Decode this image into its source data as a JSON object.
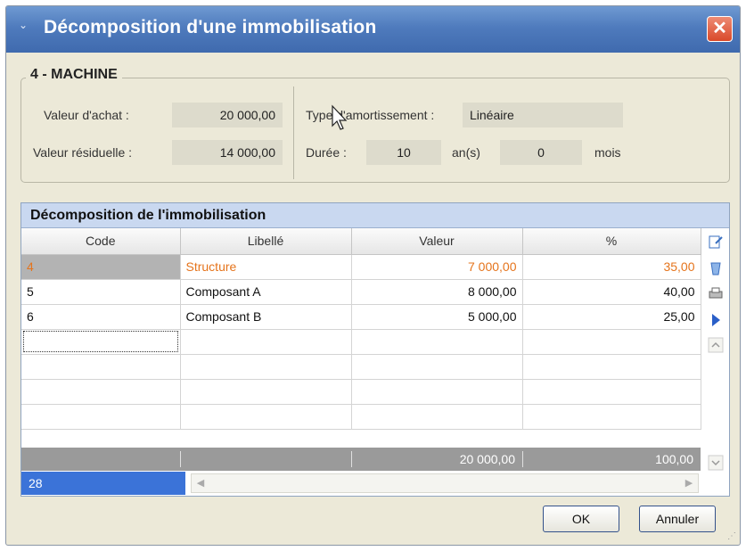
{
  "window": {
    "title": "Décomposition d'une immobilisation",
    "system_icon": "⌄",
    "close_glyph": "✕"
  },
  "group": {
    "title": "4 - MACHINE",
    "valeur_achat_label": "Valeur d'achat :",
    "valeur_achat": "20 000,00",
    "valeur_residuelle_label": "Valeur résiduelle :",
    "valeur_residuelle": "14 000,00",
    "type_label": "Type d'amortissement :",
    "type_value": "Linéaire",
    "duree_label": "Durée :",
    "duree_years": "10",
    "years_unit": "an(s)",
    "duree_months": "0",
    "months_unit": "mois"
  },
  "grid": {
    "caption": "Décomposition de l'immobilisation",
    "columns": [
      "Code",
      "Libellé",
      "Valeur",
      "%"
    ],
    "rows": [
      {
        "code": "4",
        "libelle": "Structure",
        "valeur": "7 000,00",
        "pct": "35,00"
      },
      {
        "code": "5",
        "libelle": "Composant A",
        "valeur": "8 000,00",
        "pct": "40,00"
      },
      {
        "code": "6",
        "libelle": "Composant B",
        "valeur": "5 000,00",
        "pct": "25,00"
      }
    ],
    "total_valeur": "20 000,00",
    "total_pct": "100,00",
    "counter": "28"
  },
  "buttons": {
    "ok": "OK",
    "cancel": "Annuler"
  },
  "colors": {
    "selected_text": "#e5741c",
    "title_bar": "#4f7bbd",
    "counter_bg": "#3b73d8"
  }
}
